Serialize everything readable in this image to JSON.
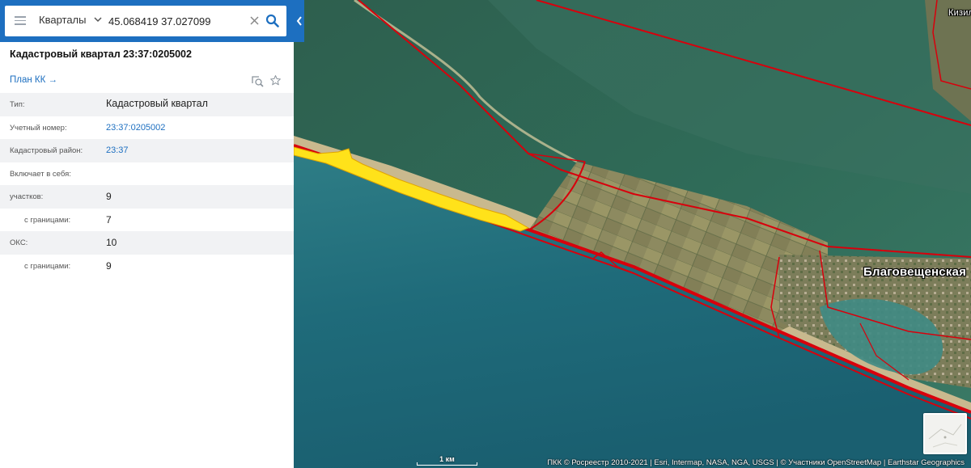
{
  "search": {
    "layer": "Кварталы",
    "query": "45.068419 37.027099"
  },
  "object": {
    "title": "Кадастровый квартал 23:37:0205002",
    "plan_link": "План КК →",
    "rows": [
      {
        "key": "Тип:",
        "value": "Кадастровый квартал",
        "kind": "text"
      },
      {
        "key": "Учетный номер:",
        "value": "23:37:0205002",
        "kind": "link"
      },
      {
        "key": "Кадастровый район:",
        "value": "23:37",
        "kind": "link"
      },
      {
        "key": "Включает в себя:",
        "value": "",
        "kind": "text"
      },
      {
        "key": "участков:",
        "value": "9",
        "kind": "text"
      },
      {
        "key": "с границами:",
        "value": "7",
        "kind": "text",
        "indent": true
      },
      {
        "key": "ОКС:",
        "value": "10",
        "kind": "text"
      },
      {
        "key": "с границами:",
        "value": "9",
        "kind": "text",
        "indent": true
      }
    ]
  },
  "map": {
    "place_labels": {
      "blagoveshchenskaya": "Благовещенская",
      "kizil": "Кизил"
    },
    "scale_label": "1 км",
    "attribution": "ПКК © Росреестр 2010-2021 | Esri, Intermap, NASA, NGA, USGS | © Участники OpenStreetMap | Earthstar Geographics",
    "boundary_color": "#d8000c",
    "selected_fill_color": "#ffe21a"
  },
  "icons": {
    "menu": "hamburger-icon",
    "dropdown": "chevron-down-icon",
    "clear": "close-icon",
    "search": "search-icon",
    "collapse": "chevron-left-icon",
    "zoom_to": "zoom-to-object-icon",
    "favorite": "star-icon"
  },
  "colors": {
    "header_blue": "#1d6fc0",
    "link_blue": "#1d6fc0"
  }
}
